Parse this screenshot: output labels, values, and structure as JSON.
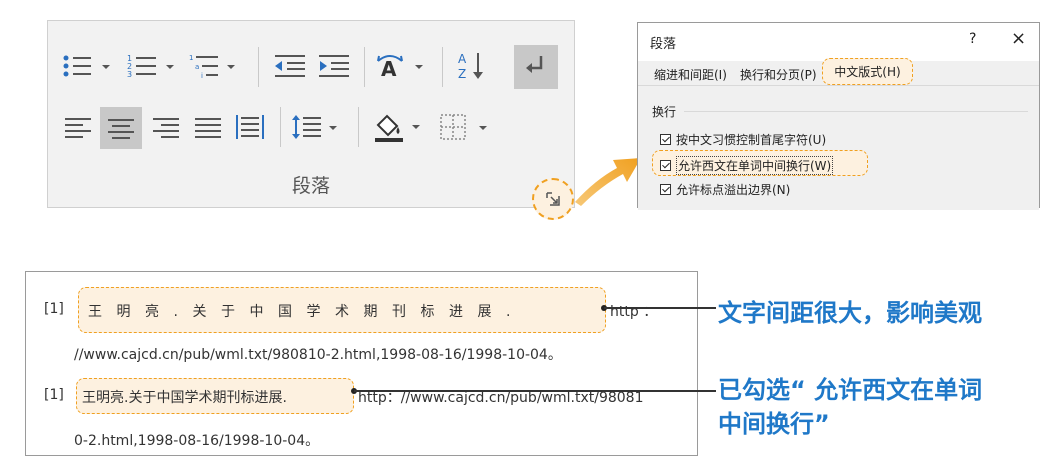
{
  "ribbon": {
    "group_label": "段落"
  },
  "dialog": {
    "title": "段落",
    "help": "?",
    "close": "×",
    "tabs": [
      "缩进和间距(I)",
      "换行和分页(P)",
      "中文版式(H)"
    ],
    "active_tab_index": 2,
    "group_label": "换行",
    "checkboxes": [
      {
        "label": "按中文习惯控制首尾字符(U)",
        "checked": true
      },
      {
        "label": "允许西文在单词中间换行(W)",
        "checked": true
      },
      {
        "label": "允许标点溢出边界(N)",
        "checked": true
      }
    ]
  },
  "example": {
    "ref1_num": "[1]",
    "ref1_spaced": "王明亮.关于中国学术期刊标进展.",
    "ref1_http": "http ：",
    "ref1_line2": "//www.cajcd.cn/pub/wml.txt/980810-2.html,1998-08-16/1998-10-04。",
    "ref2_num": "[1]",
    "ref2_title": "王明亮.关于中国学术期刊标进展.",
    "ref2_url": "http：//www.cajcd.cn/pub/wml.txt/98081",
    "ref2_line2": "0-2.html,1998-08-16/1998-10-04。"
  },
  "callouts": {
    "top": "文字间距很大，影响美观",
    "bottom_line1": "已勾选“ 允许西文在单词",
    "bottom_line2": "中间换行”"
  },
  "colors": {
    "accent_orange": "#f0a020",
    "highlight_fill": "#fdf1e0",
    "callout_blue": "#1f78c8",
    "icon_blue": "#2a6fbf"
  }
}
